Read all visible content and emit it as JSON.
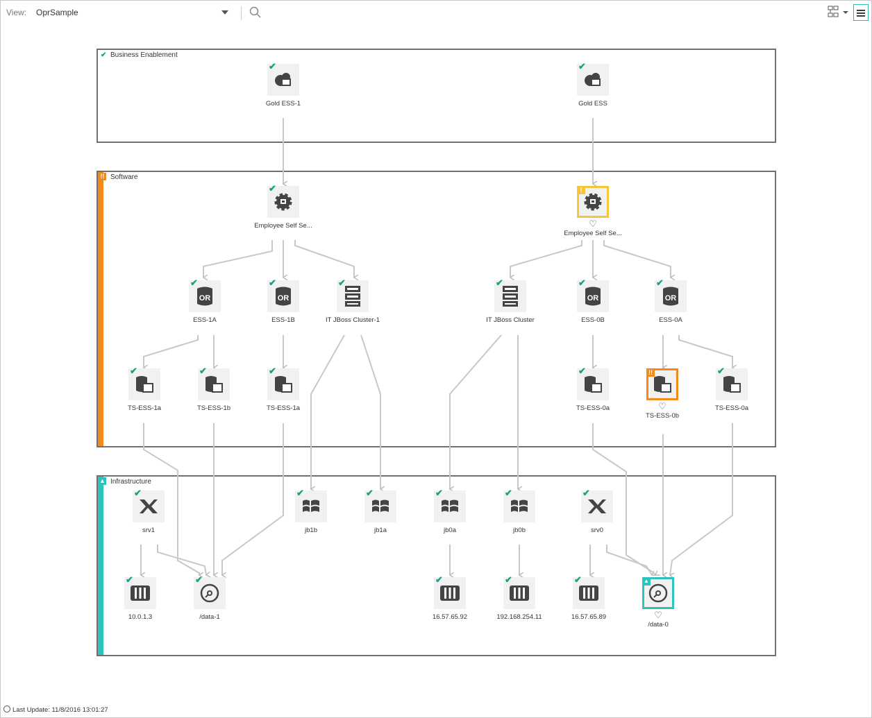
{
  "toolbar": {
    "view_label": "View:",
    "view_value": "OprSample"
  },
  "groups": [
    {
      "title": "Business Enablement",
      "status": "ok"
    },
    {
      "title": "Software",
      "status": "critical",
      "color": "#f08a1d"
    },
    {
      "title": "Infrastructure",
      "status": "warning",
      "color": "#2fc1bb"
    }
  ],
  "nodes": {
    "gold_ess_1": {
      "label": "Gold ESS-1",
      "icon": "business-service-icon",
      "status": "ok"
    },
    "gold_ess": {
      "label": "Gold ESS",
      "icon": "business-service-icon",
      "status": "ok"
    },
    "emp_self_1": {
      "label": "Employee Self Se...",
      "icon": "application-gear-icon",
      "status": "ok"
    },
    "emp_self_2": {
      "label": "Employee Self Se...",
      "icon": "application-gear-icon",
      "status": "minor",
      "heart": "♡"
    },
    "ess_1a": {
      "label": "ESS-1A",
      "icon": "oracle-db-icon",
      "status": "ok"
    },
    "ess_1b": {
      "label": "ESS-1B",
      "icon": "oracle-db-icon",
      "status": "ok"
    },
    "jboss_1": {
      "label": "IT JBoss Cluster-1",
      "icon": "cluster-icon",
      "status": "ok"
    },
    "jboss": {
      "label": "IT JBoss Cluster",
      "icon": "cluster-icon",
      "status": "ok"
    },
    "ess_0b": {
      "label": "ESS-0B",
      "icon": "oracle-db-icon",
      "status": "ok"
    },
    "ess_0a": {
      "label": "ESS-0A",
      "icon": "oracle-db-icon",
      "status": "ok"
    },
    "ts_ess_1a": {
      "label": "TS-ESS-1a",
      "icon": "tablespace-icon",
      "status": "ok"
    },
    "ts_ess_1b": {
      "label": "TS-ESS-1b",
      "icon": "tablespace-icon",
      "status": "ok"
    },
    "ts_ess_1a_2": {
      "label": "TS-ESS-1a",
      "icon": "tablespace-icon",
      "status": "ok"
    },
    "ts_ess_0a": {
      "label": "TS-ESS-0a",
      "icon": "tablespace-icon",
      "status": "ok"
    },
    "ts_ess_0b": {
      "label": "TS-ESS-0b",
      "icon": "tablespace-icon",
      "status": "critical",
      "heart": "♡"
    },
    "ts_ess_0a_2": {
      "label": "TS-ESS-0a",
      "icon": "tablespace-icon",
      "status": "ok"
    },
    "srv1": {
      "label": "srv1",
      "icon": "unix-server-icon",
      "status": "ok"
    },
    "jb1b": {
      "label": "jb1b",
      "icon": "windows-icon",
      "status": "ok"
    },
    "jb1a": {
      "label": "jb1a",
      "icon": "windows-icon",
      "status": "ok"
    },
    "jb0a": {
      "label": "jb0a",
      "icon": "windows-icon",
      "status": "ok"
    },
    "jb0b": {
      "label": "jb0b",
      "icon": "windows-icon",
      "status": "ok"
    },
    "srv0": {
      "label": "srv0",
      "icon": "unix-server-icon",
      "status": "ok"
    },
    "ip_10013": {
      "label": "10.0.1.3",
      "icon": "network-interface-icon",
      "status": "ok"
    },
    "data_1": {
      "label": "/data-1",
      "icon": "disk-icon",
      "status": "ok"
    },
    "ip_16576592": {
      "label": "16.57.65.92",
      "icon": "network-interface-icon",
      "status": "ok"
    },
    "ip_19216825411": {
      "label": "192.168.254.11",
      "icon": "network-interface-icon",
      "status": "ok"
    },
    "ip_16576589": {
      "label": "16.57.65.89",
      "icon": "network-interface-icon",
      "status": "ok"
    },
    "data_0": {
      "label": "/data-0",
      "icon": "disk-icon",
      "status": "warning",
      "heart": "♡"
    }
  },
  "footer": {
    "last_update": "Last Update: 11/8/2016 13:01:27"
  },
  "colors": {
    "ok": "#1aa087",
    "minor": "#f5c53b",
    "critical": "#f08a1d",
    "warning": "#2fc1bb"
  }
}
